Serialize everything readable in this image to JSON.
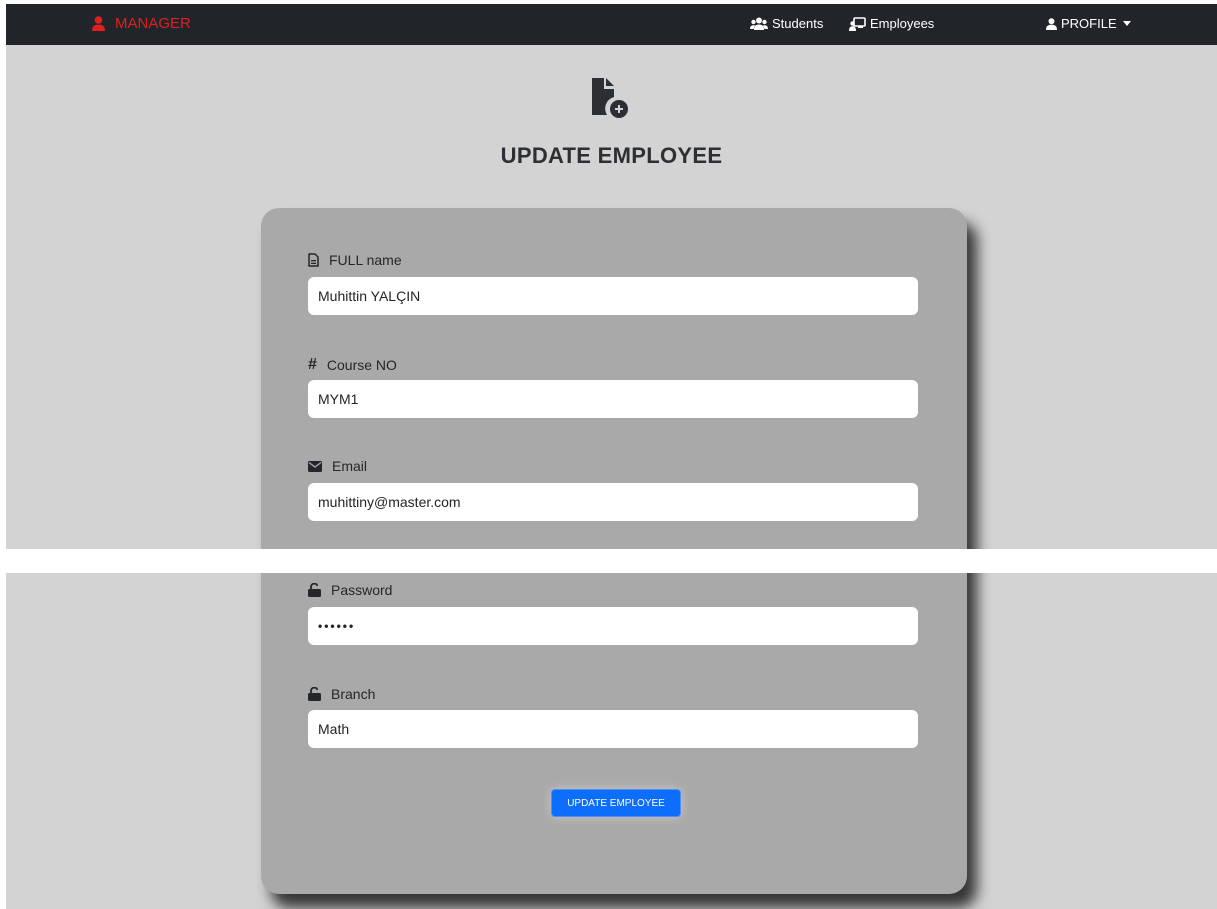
{
  "navbar": {
    "brand": "MANAGER",
    "students": "Students",
    "employees": "Employees",
    "profile": "PROFILE"
  },
  "page": {
    "title": "UPDATE EMPLOYEE"
  },
  "form": {
    "full_name": {
      "label": "FULL name",
      "value": "Muhittin YALÇIN"
    },
    "course_no": {
      "label": "Course NO",
      "value": "MYM1"
    },
    "email": {
      "label": "Email",
      "value": "muhittiny@master.com"
    },
    "password": {
      "label": "Password",
      "value": "••••••"
    },
    "branch": {
      "label": "Branch",
      "value": "Math"
    },
    "submit_label": "UPDATE EMPLOYEE"
  },
  "icons": {
    "brand": "user-icon",
    "students": "users-icon",
    "employees": "chalkboard-user-icon",
    "profile": "user-icon",
    "header": "file-circle-plus-icon",
    "full_name": "file-lines-icon",
    "course_no": "hashtag-icon",
    "email": "envelope-icon",
    "password": "lock-open-icon",
    "branch": "lock-open-icon"
  },
  "colors": {
    "navbar_bg": "#212529",
    "brand": "#e02020",
    "page_bg": "#d3d3d3",
    "card_bg": "#a9a9a9",
    "button_bg": "#0d6efd"
  }
}
